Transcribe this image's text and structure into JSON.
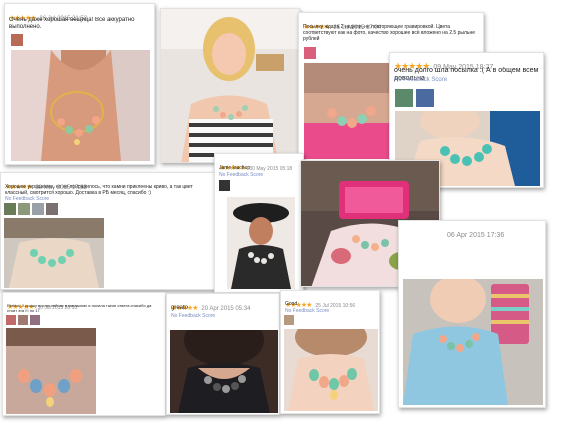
{
  "stars": "★★★★★",
  "reviews": [
    {
      "date": "26 Jul 2015 21:53",
      "text": "Очень даже хорошая вещица! Все аккуратно выполнено.",
      "feedback": "No Feedback Score"
    },
    {
      "date": "",
      "text": "",
      "feedback": ""
    },
    {
      "date": "25 Jul 2015 17:04",
      "text": "Посылку ждала 2 недели, не повторяющее гравировкой. Цвета соответствуют как на фото, качество хорошее всё вложено на 2.5 рыльне рублей",
      "feedback": "No Feedback Score"
    },
    {
      "date": "09 May 2015 18:27",
      "text": "очень долго шла посылка :( А в общем всем довольна",
      "feedback": "No Feedback Score"
    },
    {
      "date": "28 May 2015 17:32",
      "text": "Хорошее украшение, но не понравилось, что камни приклеены криво, а так цвет классный, смотрится хорошо. Доставка в РБ месяц, спасибо :)",
      "feedback": "No Feedback Score"
    },
    {
      "date": "30 May 2015 05:18",
      "text": "Jame lauchup",
      "feedback": "No Feedback Score"
    },
    {
      "date": "",
      "text": "",
      "feedback": ""
    },
    {
      "date": "06 Apr 2015 17:36",
      "text": "",
      "feedback": ""
    },
    {
      "date": "30 Jul 2015 20:10",
      "text": "Perfect, !! прошу нослю сейчас в магазинах я носила такое ответа спасибо да стоит эта !!! но 17",
      "feedback": ""
    },
    {
      "date": "20 Apr 2015 05:34",
      "text": "greato",
      "feedback": "No Feedback Score"
    },
    {
      "date": "25 Jul 2015 10:56",
      "text": "Good",
      "feedback": "No Feedback Score"
    }
  ],
  "colors": {
    "star": "#f5a623",
    "feedback": "#7a8cc0"
  }
}
